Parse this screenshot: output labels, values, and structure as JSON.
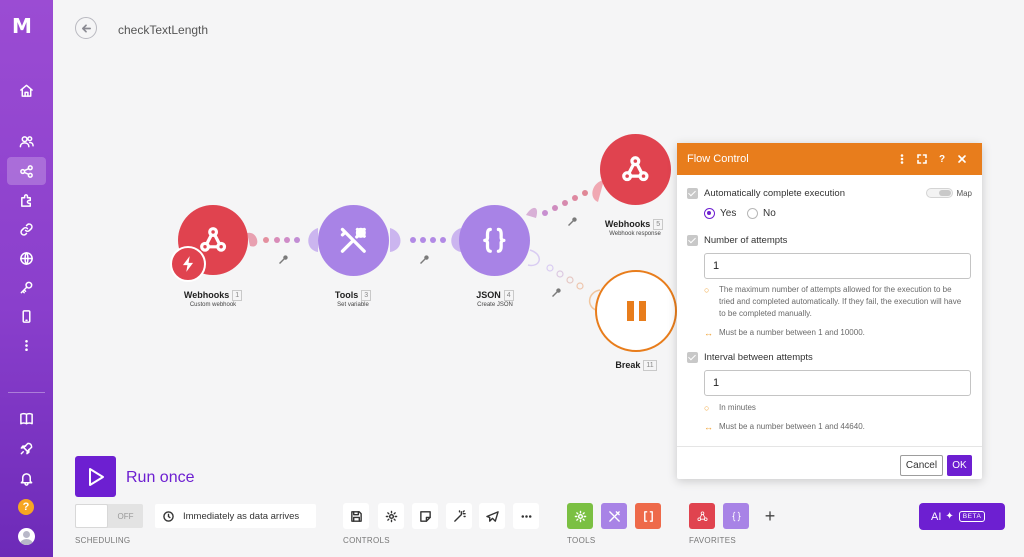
{
  "app": {
    "logo_text": "M"
  },
  "header": {
    "title": "checkTextLength"
  },
  "nodes": {
    "webhooks_trigger": {
      "label": "Webhooks",
      "num": "1",
      "sub": "Custom webhook"
    },
    "tools": {
      "label": "Tools",
      "num": "3",
      "sub": "Set variable"
    },
    "json": {
      "label": "JSON",
      "num": "4",
      "sub": "Create JSON"
    },
    "webhook_response": {
      "label": "Webhooks",
      "num": "5",
      "sub": "Webhook response"
    },
    "break": {
      "label": "Break",
      "num": "11"
    }
  },
  "panel": {
    "title": "Flow Control",
    "auto_complete_label": "Automatically complete execution",
    "map_label": "Map",
    "radio_yes": "Yes",
    "radio_no": "No",
    "attempts_label": "Number of attempts",
    "attempts_value": "1",
    "attempts_hint": "The maximum number of attempts allowed for the execution to be tried and completed automatically. If they fail, the execution will have to be completed manually.",
    "attempts_range": "Must be a number between 1 and 10000.",
    "interval_label": "Interval between attempts",
    "interval_value": "1",
    "interval_hint": "In minutes",
    "interval_range": "Must be a number between 1 and 44640.",
    "cancel_label": "Cancel",
    "ok_label": "OK"
  },
  "toolbar": {
    "run_label": "Run once",
    "toggle_off": "OFF",
    "schedule_mode": "Immediately as data arrives",
    "scheduling_label": "SCHEDULING",
    "controls_label": "CONTROLS",
    "tools_label": "TOOLS",
    "favorites_label": "FAVORITES",
    "ai_label": "AI",
    "beta_label": "BETA",
    "plus": "+"
  },
  "colors": {
    "webhooks": "#e0434f",
    "tools": "#a883e6",
    "json": "#a883e6",
    "flow_control": "#e87d1c",
    "brand": "#6d1fd1"
  }
}
